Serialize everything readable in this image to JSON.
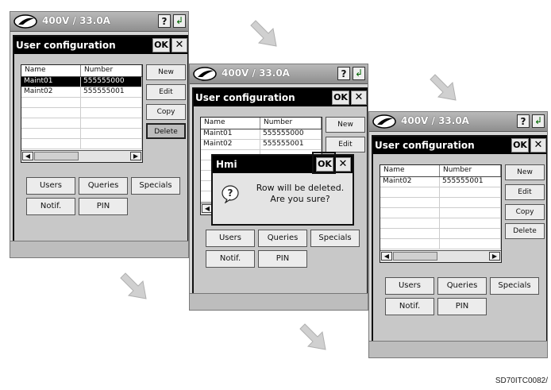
{
  "screens": [
    {
      "power_label": "400V / 33.0A",
      "dialog_title": "User configuration",
      "ok_label": "OK",
      "close_label": "✕",
      "columns": [
        "Name",
        "Number"
      ],
      "rows": [
        {
          "name": "Maint01",
          "number": "555555000",
          "selected": true
        },
        {
          "name": "Maint02",
          "number": "555555001",
          "selected": false
        }
      ],
      "side_buttons": [
        "New",
        "Edit",
        "Copy",
        "Delete"
      ],
      "pressed_button": "Delete",
      "grid_buttons": [
        "Users",
        "Queries",
        "Specials",
        "Notif.",
        "PIN"
      ]
    },
    {
      "power_label": "400V / 33.0A",
      "dialog_title": "User configuration",
      "ok_label": "OK",
      "close_label": "✕",
      "columns": [
        "Name",
        "Number"
      ],
      "rows": [
        {
          "name": "Maint01",
          "number": "555555000",
          "selected": false
        },
        {
          "name": "Maint02",
          "number": "555555001",
          "selected": false
        }
      ],
      "side_buttons": [
        "New",
        "Edit"
      ],
      "grid_buttons": [
        "Users",
        "Queries",
        "Specials",
        "Notif.",
        "PIN"
      ],
      "message_box": {
        "title": "Hmi",
        "ok_label": "OK",
        "close_label": "✕",
        "line1": "Row will be deleted.",
        "line2": "Are you sure?"
      }
    },
    {
      "power_label": "400V / 33.0A",
      "dialog_title": "User configuration",
      "ok_label": "OK",
      "close_label": "✕",
      "columns": [
        "Name",
        "Number"
      ],
      "rows": [
        {
          "name": "Maint02",
          "number": "555555001",
          "selected": false
        }
      ],
      "side_buttons": [
        "New",
        "Edit",
        "Copy",
        "Delete"
      ],
      "grid_buttons": [
        "Users",
        "Queries",
        "Specials",
        "Notif.",
        "PIN"
      ]
    }
  ],
  "help_label": "?",
  "exit_glyph": "↲",
  "figure_code": "SD70ITC0082/",
  "icons": [
    "logo-icon",
    "help-icon",
    "exit-icon",
    "question-icon",
    "arrow-icon"
  ],
  "colors": {
    "titlebar": "#000000",
    "panel": "#d6d6d6",
    "selected_row": "#000000",
    "arrow": "#d0d0d0"
  }
}
